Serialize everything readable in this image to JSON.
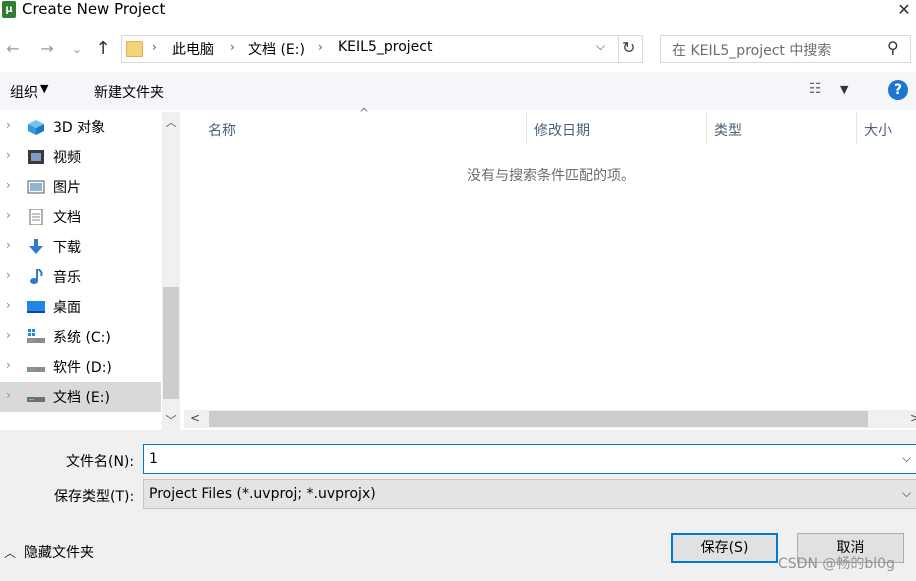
{
  "window": {
    "title": "Create New Project",
    "close_glyph": "✕"
  },
  "nav": {
    "back": "←",
    "forward": "→",
    "recent": "⌄",
    "up": "↑"
  },
  "address": {
    "separator": "›",
    "breadcrumbs": [
      "此电脑",
      "文档 (E:)",
      "KEIL5_project"
    ],
    "dropdown": "⌵",
    "refresh": "↻"
  },
  "search": {
    "placeholder": "在 KEIL5_project 中搜索",
    "icon": "search-icon"
  },
  "toolbar": {
    "organize": "组织",
    "organize_arrow": "▼",
    "new_folder": "新建文件夹",
    "view_glyph": "☷",
    "view_arrow": "▼",
    "help": "?"
  },
  "sidebar": {
    "chevron": "›",
    "items": [
      {
        "label": "3D 对象",
        "icon": "3d-objects-icon"
      },
      {
        "label": "视频",
        "icon": "video-icon"
      },
      {
        "label": "图片",
        "icon": "pictures-icon"
      },
      {
        "label": "文档",
        "icon": "documents-icon"
      },
      {
        "label": "下载",
        "icon": "download-icon"
      },
      {
        "label": "音乐",
        "icon": "music-icon"
      },
      {
        "label": "桌面",
        "icon": "desktop-icon"
      },
      {
        "label": "系统 (C:)",
        "icon": "system-drive-icon"
      },
      {
        "label": "软件 (D:)",
        "icon": "drive-icon"
      },
      {
        "label": "文档 (E:)",
        "icon": "drive-icon",
        "selected": true
      }
    ],
    "scroll_up": "︿",
    "scroll_down": "﹀"
  },
  "filelist": {
    "sort_indicator": "^",
    "columns": [
      "名称",
      "修改日期",
      "类型",
      "大小"
    ],
    "empty_message": "没有与搜索条件匹配的项。",
    "scroll_left": "<",
    "scroll_right": ">"
  },
  "form": {
    "filename_label": "文件名(N):",
    "filename_value": "1",
    "filetype_label": "保存类型(T):",
    "filetype_value": "Project Files (*.uvproj; *.uvprojx)",
    "dropdown_glyph": "⌵"
  },
  "footer": {
    "hide_arrow": "︿",
    "hide_folders": "隐藏文件夹",
    "save": "保存(S)",
    "cancel": "取消",
    "watermark": "CSDN @畅的bl0g"
  },
  "colors": {
    "accent": "#0078d7",
    "help": "#1c75d1",
    "selected_row": "#d9d9d9",
    "column_header": "#4c607a"
  }
}
